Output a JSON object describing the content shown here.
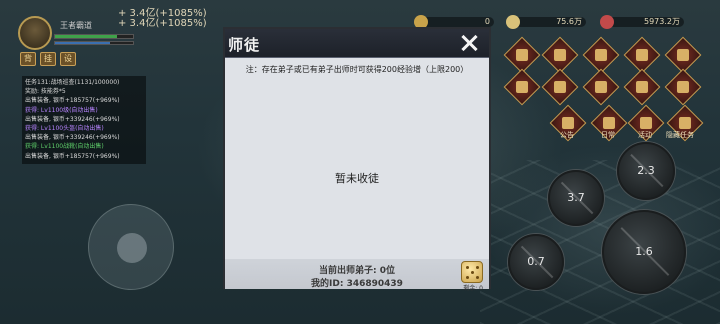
{
  "player": {
    "name": "王者霸道",
    "gains": [
      "+ 3.4亿(+1085%)",
      "+ 3.4亿(+1085%)"
    ],
    "side_buttons": [
      "背",
      "挂",
      "设"
    ]
  },
  "quest_log": {
    "lines": [
      {
        "text": "任务131:战场巡查(1131/100000)",
        "color": "w"
      },
      {
        "text": "奖励: 技能券*5",
        "color": "w"
      },
      {
        "text": "出售装备, 银币+185757(+969%)",
        "color": "w"
      },
      {
        "text": "获得: Lv1100级(自动出售)",
        "color": "p"
      },
      {
        "text": "出售装备, 银币+339246(+969%)",
        "color": "w"
      },
      {
        "text": "获得: Lv1100头盔(自动出售)",
        "color": "p"
      },
      {
        "text": "出售装备, 银币+339246(+969%)",
        "color": "w"
      },
      {
        "text": "获得: Lv1100战靴(自动出售)",
        "color": "g"
      },
      {
        "text": "出售装备, 银币+185757(+969%)",
        "color": "w"
      }
    ]
  },
  "resources": {
    "first": "0",
    "second": "75.6万",
    "third": "5973.2万"
  },
  "menu_icons": {
    "labels": [
      "公告",
      "日常",
      "活动",
      "隐藏任务"
    ]
  },
  "skills": {
    "cooldowns": [
      "2.3",
      "3.7",
      "1.6",
      "0.7"
    ]
  },
  "dialog": {
    "title": "师徒",
    "note": "注：存在弟子或已有弟子出师时可获得200经验增（上限200）",
    "empty_message": "暂未收徒",
    "footer": {
      "disciples_label": "当前出师弟子: 0位",
      "my_id_label": "我的ID: 346890439"
    },
    "dice_caption": "剩余: 0"
  },
  "colors": {
    "dialog_bg": "#dfe2e7",
    "dialog_header": "#1d2129",
    "quest_white": "#d9d9d9",
    "quest_purple": "#b784ff",
    "quest_green": "#5fd06a"
  }
}
